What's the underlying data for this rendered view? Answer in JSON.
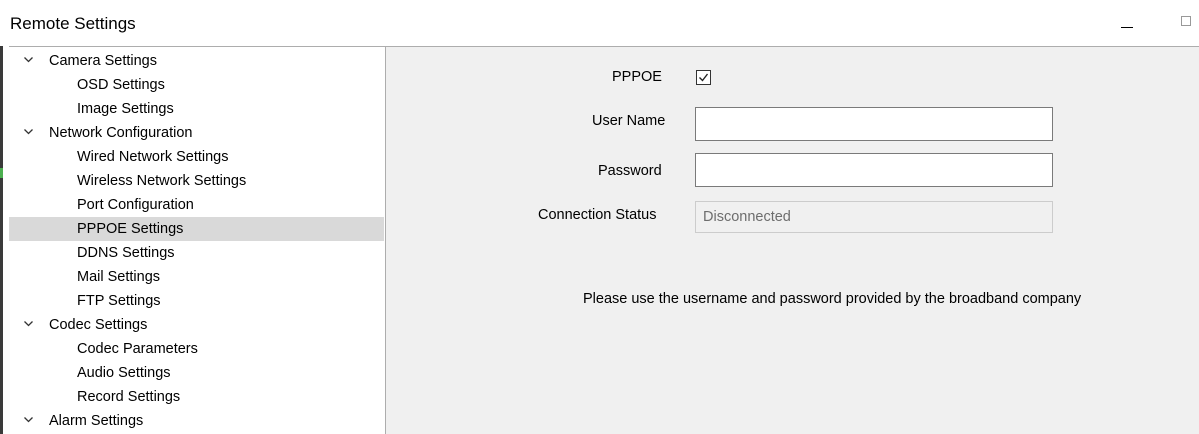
{
  "window": {
    "title": "Remote Settings"
  },
  "tree": {
    "items": [
      {
        "label": "Camera Settings",
        "level": 0,
        "expanded": true
      },
      {
        "label": "OSD Settings",
        "level": 1
      },
      {
        "label": "Image Settings",
        "level": 1
      },
      {
        "label": "Network Configuration",
        "level": 0,
        "expanded": true
      },
      {
        "label": "Wired Network Settings",
        "level": 1
      },
      {
        "label": "Wireless Network Settings",
        "level": 1
      },
      {
        "label": "Port Configuration",
        "level": 1
      },
      {
        "label": "PPPOE Settings",
        "level": 1,
        "selected": true
      },
      {
        "label": "DDNS Settings",
        "level": 1
      },
      {
        "label": "Mail Settings",
        "level": 1
      },
      {
        "label": "FTP Settings",
        "level": 1
      },
      {
        "label": "Codec Settings",
        "level": 0,
        "expanded": true
      },
      {
        "label": "Codec Parameters",
        "level": 1
      },
      {
        "label": "Audio Settings",
        "level": 1
      },
      {
        "label": "Record Settings",
        "level": 1
      },
      {
        "label": "Alarm Settings",
        "level": 0,
        "expanded": true
      }
    ]
  },
  "form": {
    "pppoe_label": "PPPOE",
    "pppoe_checked": true,
    "username_label": "User Name",
    "username_value": "",
    "password_label": "Password",
    "password_value": "",
    "status_label": "Connection Status",
    "status_value": "Disconnected",
    "note": "Please use the username and password provided by the broadband company"
  },
  "colors": {
    "selected_row": "#d9d9d9",
    "content_background": "#f0f0f0",
    "status_text": "#6d6d6d"
  }
}
